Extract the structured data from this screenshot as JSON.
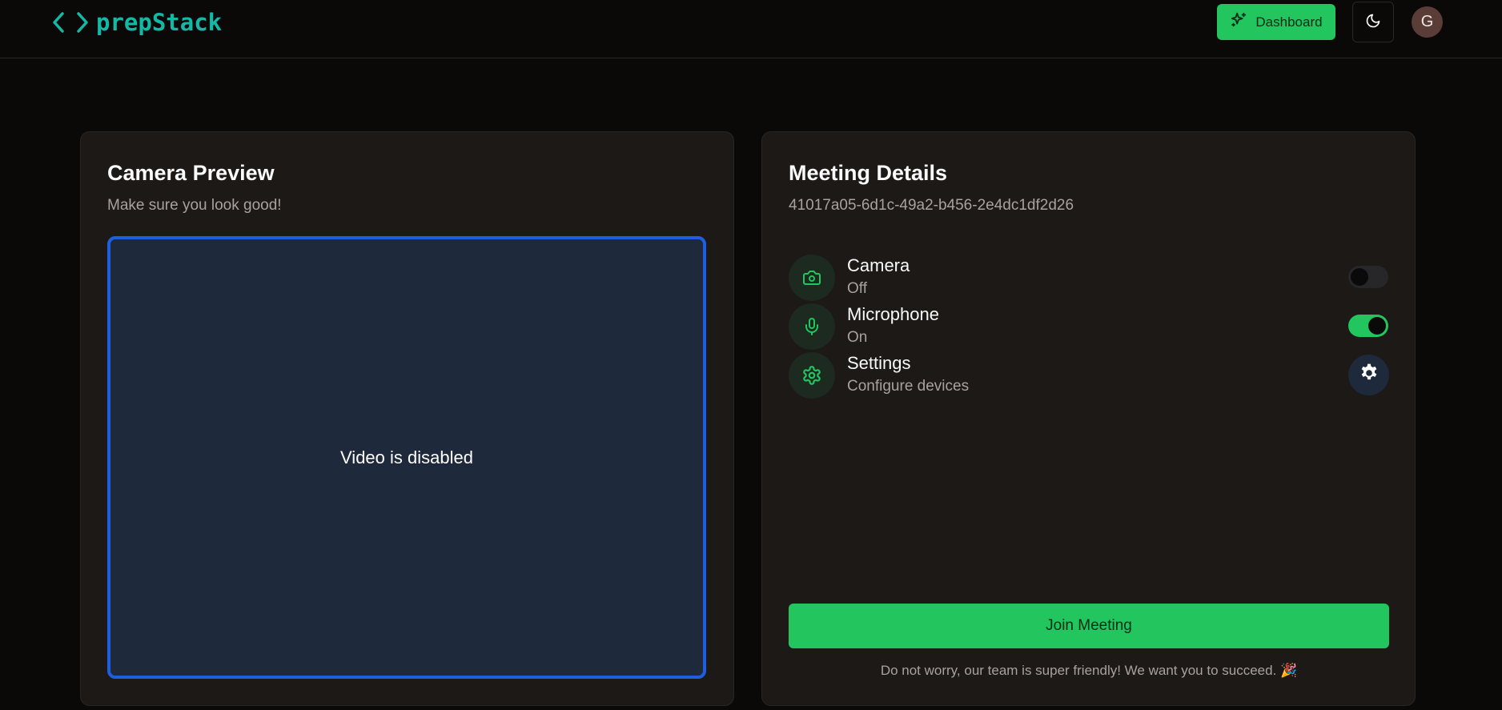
{
  "header": {
    "logo_text": "prepStack",
    "dashboard_label": "Dashboard",
    "avatar_initial": "G"
  },
  "camera_preview": {
    "title": "Camera Preview",
    "subtitle": "Make sure you look good!",
    "video_status": "Video is disabled"
  },
  "meeting_details": {
    "title": "Meeting Details",
    "meeting_id": "41017a05-6d1c-49a2-b456-2e4dc1df2d26",
    "camera": {
      "label": "Camera",
      "status": "Off",
      "enabled": false
    },
    "microphone": {
      "label": "Microphone",
      "status": "On",
      "enabled": true
    },
    "settings": {
      "label": "Settings",
      "status": "Configure devices"
    },
    "join_label": "Join Meeting",
    "footnote": "Do not worry, our team is super friendly! We want you to succeed. 🎉"
  },
  "colors": {
    "accent": "#22c55e",
    "logo": "#14b8a6",
    "video_border": "#1d5fe0",
    "card_bg": "#1c1917",
    "page_bg": "#0a0908"
  },
  "icons": {
    "logo": "code-brackets-icon",
    "dashboard": "sparkles-icon",
    "theme": "moon-icon",
    "camera": "camera-icon",
    "microphone": "mic-icon",
    "settings": "settings-icon",
    "settings_button": "gear-icon"
  }
}
